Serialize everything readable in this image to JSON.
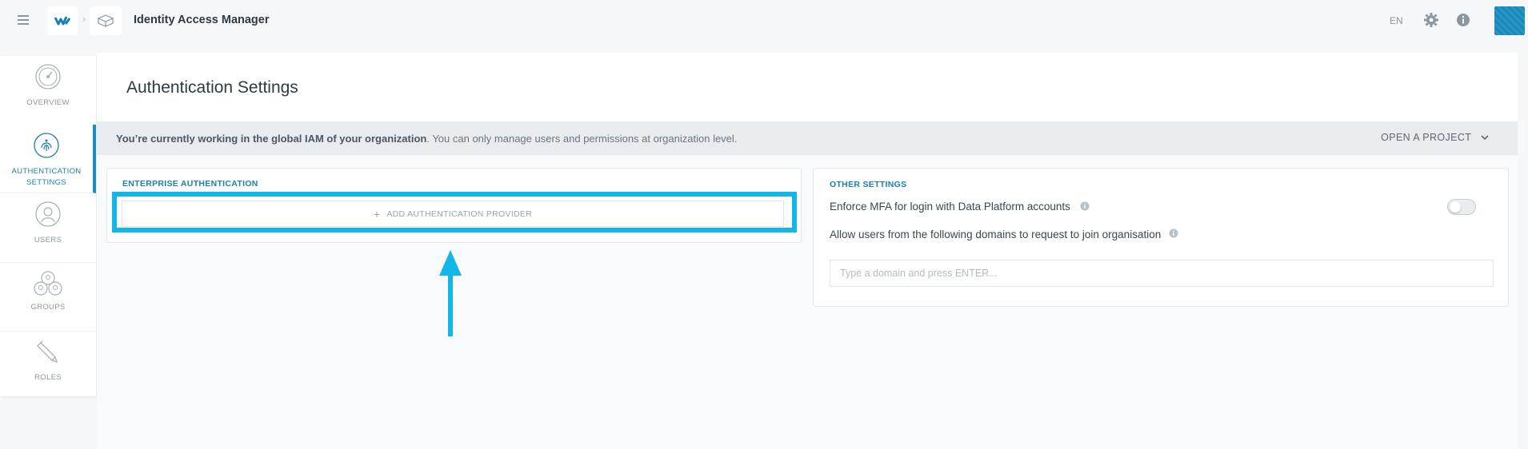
{
  "app": {
    "title": "Identity Access Manager",
    "language": "EN",
    "accent_color": "#1b8ebf",
    "highlight_color": "#12b7e8"
  },
  "header_icons": [
    "menu-icon",
    "brand-logo-icon",
    "chevron-right-icon",
    "cube-icon",
    "gear-icon",
    "info-icon",
    "avatar"
  ],
  "sidebar": {
    "items": [
      {
        "label_line1": "OVERVIEW",
        "label_line2": "",
        "icon": "gauge-icon",
        "active": false
      },
      {
        "label_line1": "AUTHENTICATION",
        "label_line2": "SETTINGS",
        "icon": "fingerprint-icon",
        "active": true
      },
      {
        "label_line1": "USERS",
        "label_line2": "",
        "icon": "user-icon",
        "active": false
      },
      {
        "label_line1": "GROUPS",
        "label_line2": "",
        "icon": "group-icon",
        "active": false
      },
      {
        "label_line1": "ROLES",
        "label_line2": "",
        "icon": "pencil-icon",
        "active": false
      }
    ]
  },
  "page": {
    "title": "Authentication Settings"
  },
  "notice": {
    "bold": "You’re currently working in the global IAM of your organization",
    "rest": ". You can only manage users and permissions at organization level.",
    "open_project": "OPEN A PROJECT"
  },
  "enterprise": {
    "title": "ENTERPRISE AUTHENTICATION",
    "add_provider": "ADD AUTHENTICATION PROVIDER"
  },
  "other": {
    "title": "OTHER SETTINGS",
    "mfa_label": "Enforce MFA for login with Data Platform accounts",
    "mfa_enabled": false,
    "domains_label": "Allow users from the following domains to request to join organisation",
    "domain_placeholder": "Type a domain and press ENTER..."
  }
}
